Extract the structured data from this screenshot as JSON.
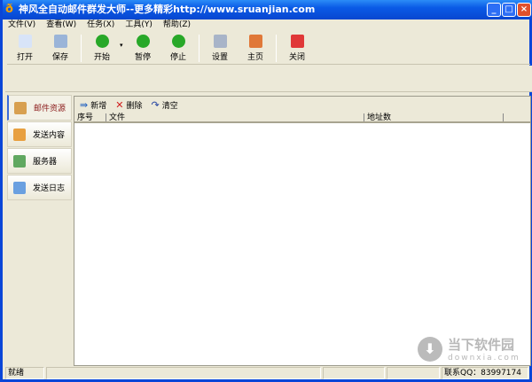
{
  "window": {
    "title": "神风全自动邮件群发大师--更多精彩http://www.sruanjian.com",
    "min": "_",
    "max": "□",
    "close": "×"
  },
  "menu": [
    "文件(V)",
    "查看(W)",
    "任务(X)",
    "工具(Y)",
    "帮助(Z)"
  ],
  "toolbar": [
    {
      "label": "打开",
      "icon": "open-icon",
      "color": "#d8e4f8"
    },
    {
      "label": "保存",
      "icon": "save-icon",
      "color": "#9ab4d8"
    },
    {
      "label": "开始",
      "icon": "play-icon",
      "color": "#28a828"
    },
    {
      "label": "暂停",
      "icon": "pause-icon",
      "color": "#28a828"
    },
    {
      "label": "停止",
      "icon": "stop-icon",
      "color": "#28a828"
    },
    {
      "label": "设置",
      "icon": "settings-icon",
      "color": "#a8b4c8"
    },
    {
      "label": "主页",
      "icon": "home-icon",
      "color": "#e07838"
    },
    {
      "label": "关闭",
      "icon": "power-icon",
      "color": "#e03838"
    }
  ],
  "sidebar": [
    {
      "label": "邮件资源",
      "icon": "mail-package-icon"
    },
    {
      "label": "发送内容",
      "icon": "content-package-icon"
    },
    {
      "label": "服务器",
      "icon": "server-icon"
    },
    {
      "label": "发送日志",
      "icon": "log-book-icon"
    }
  ],
  "subtoolbar": {
    "add": "新增",
    "delete": "删除",
    "clear": "清空"
  },
  "table": {
    "columns": [
      "序号",
      "文件",
      "地址数"
    ],
    "rows": []
  },
  "status": {
    "ready": "就绪",
    "qq": "联系QQ：83997174"
  },
  "watermark": {
    "name": "当下软件园",
    "url": "downxia.com"
  }
}
